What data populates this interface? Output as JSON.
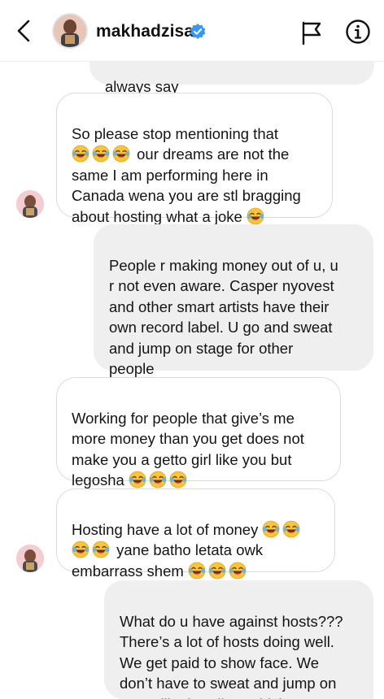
{
  "header": {
    "username": "makhadzisa",
    "back_icon": "chevron-left-icon",
    "verified_icon": "verified-badge-icon",
    "flag_icon": "flag-icon",
    "info_icon": "info-icon"
  },
  "messages": [
    {
      "side": "sent",
      "text": "always say"
    },
    {
      "side": "received",
      "text": "So please stop mentioning  that\n{e}{e}{e} our dreams are not the\nsame I am performing here in\nCanada wena you are stl bragging\nabout hosting what a joke {e}"
    },
    {
      "side": "sent",
      "text": "People r making money out of u, u\nr not even aware. Casper nyovest\nand other smart artists have their\nown record label. U go and sweat\nand jump on stage for other\npeople"
    },
    {
      "side": "received",
      "text": "Working for people that  give’s me\nmore money than you get does not\nmake you a getto girl like you but\nlegosha {e}{e}{e}"
    },
    {
      "side": "received",
      "text": "Hosting have a lot of money {e}{e}\n{e}{e} yane batho letata owk\nembarrass shem {e}{e}{e}"
    },
    {
      "side": "sent",
      "text": "What do u have against hosts???\nThere’s a lot of hosts doing well.\nWe get paid to show face. We\ndon’t have to sweat and jump on\nstage like headless chicken"
    }
  ],
  "emoji_name": "face-with-tears-of-joy-emoji",
  "colors": {
    "sent_bubble": "#efefef",
    "received_border": "#dcdcdc",
    "verified_blue": "#3897f0"
  }
}
